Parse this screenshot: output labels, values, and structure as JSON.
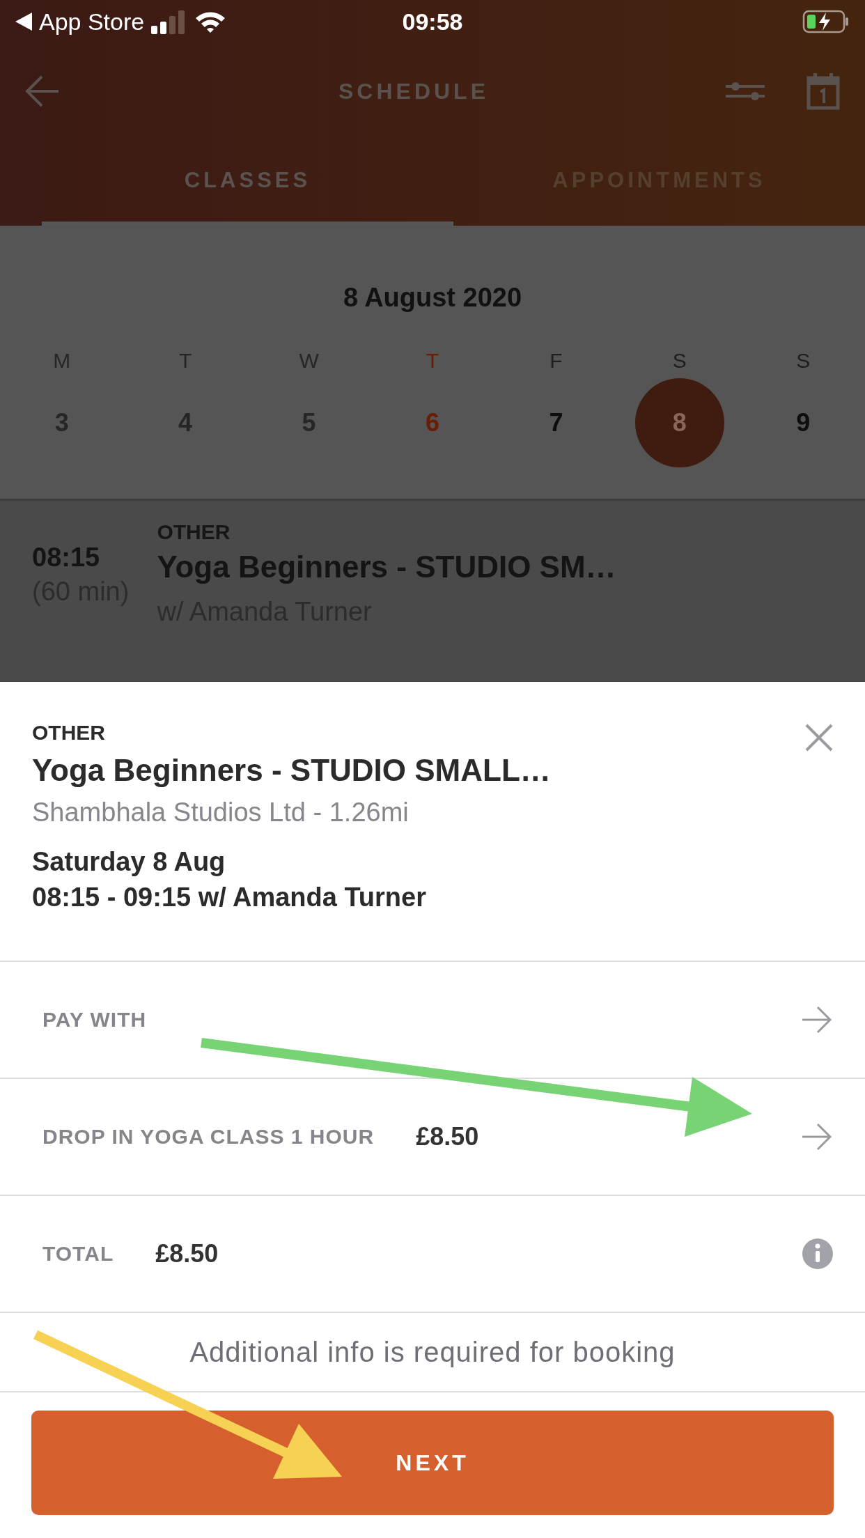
{
  "status_bar": {
    "back_label": "App Store",
    "time": "09:58"
  },
  "header": {
    "title": "SCHEDULE"
  },
  "tabs": [
    {
      "label": "CLASSES",
      "selected": true
    },
    {
      "label": "APPOINTMENTS",
      "selected": false
    }
  ],
  "calendar": {
    "month_title": "8 August 2020",
    "days": [
      {
        "weekday": "M",
        "date": "3",
        "kind": "past",
        "selected": false
      },
      {
        "weekday": "T",
        "date": "4",
        "kind": "past",
        "selected": false
      },
      {
        "weekday": "W",
        "date": "5",
        "kind": "past",
        "selected": false
      },
      {
        "weekday": "T",
        "date": "6",
        "kind": "today",
        "selected": false
      },
      {
        "weekday": "F",
        "date": "7",
        "kind": "future",
        "selected": false
      },
      {
        "weekday": "S",
        "date": "8",
        "kind": "future",
        "selected": true
      },
      {
        "weekday": "S",
        "date": "9",
        "kind": "future",
        "selected": false
      }
    ]
  },
  "class_row": {
    "time": "08:15",
    "duration": "(60 min)",
    "category": "OTHER",
    "title": "Yoga Beginners - STUDIO SM…",
    "instructor": "w/ Amanda Turner"
  },
  "sheet": {
    "category": "OTHER",
    "title": "Yoga Beginners - STUDIO SMALL…",
    "location": "Shambhala Studios Ltd - 1.26mi",
    "date": "Saturday 8 Aug",
    "time_line": "08:15 - 09:15 w/ Amanda Turner"
  },
  "rows": [
    {
      "kind": "link",
      "label": "PAY WITH"
    },
    {
      "kind": "link",
      "label": "DROP IN YOGA CLASS 1 HOUR",
      "value": "£8.50"
    },
    {
      "kind": "info",
      "label": "TOTAL",
      "value": "£8.50"
    }
  ],
  "notice": "Additional info is required for booking",
  "button": "NEXT"
}
